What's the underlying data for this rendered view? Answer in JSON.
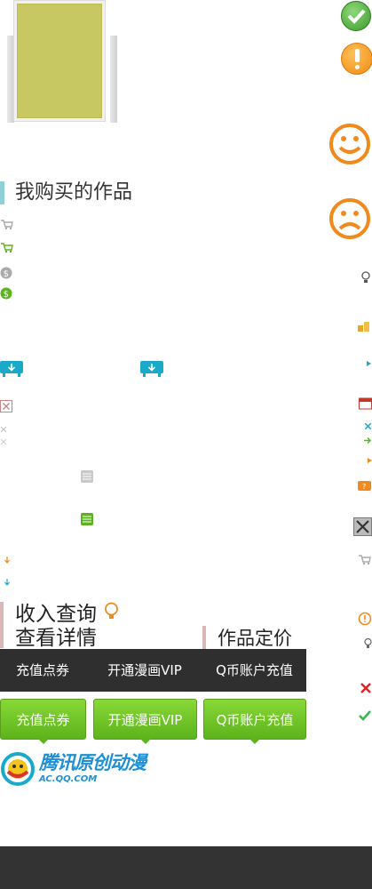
{
  "section": {
    "title": "我购买的作品"
  },
  "labels": {
    "income_query": "收入查询",
    "view_details": "查看详情",
    "work_pricing": "作品定价"
  },
  "recharge_bar": {
    "items": [
      "充值点券",
      "开通漫画VIP",
      "Q币账户充值"
    ]
  },
  "recharge_buttons": {
    "items": [
      "充值点券",
      "开通漫画VIP",
      "Q币账户充值"
    ]
  },
  "logo": {
    "name": "腾讯原创动漫",
    "domain": "AC.QQ.COM"
  },
  "colors": {
    "accent_teal": "#1aa9c9",
    "green": "#5db31c",
    "orange": "#f08a1c",
    "dark_bar": "#2f2f2f",
    "footer": "#333333",
    "cover": "#c8c863"
  },
  "icons": {
    "status": [
      "check-circle-icon",
      "warning-circle-icon",
      "smile-icon",
      "sad-icon"
    ],
    "sprites": [
      "cart-icon",
      "coin-icon",
      "download-box-icon",
      "close-icon",
      "calendar-icon",
      "bulb-icon",
      "info-icon"
    ]
  }
}
